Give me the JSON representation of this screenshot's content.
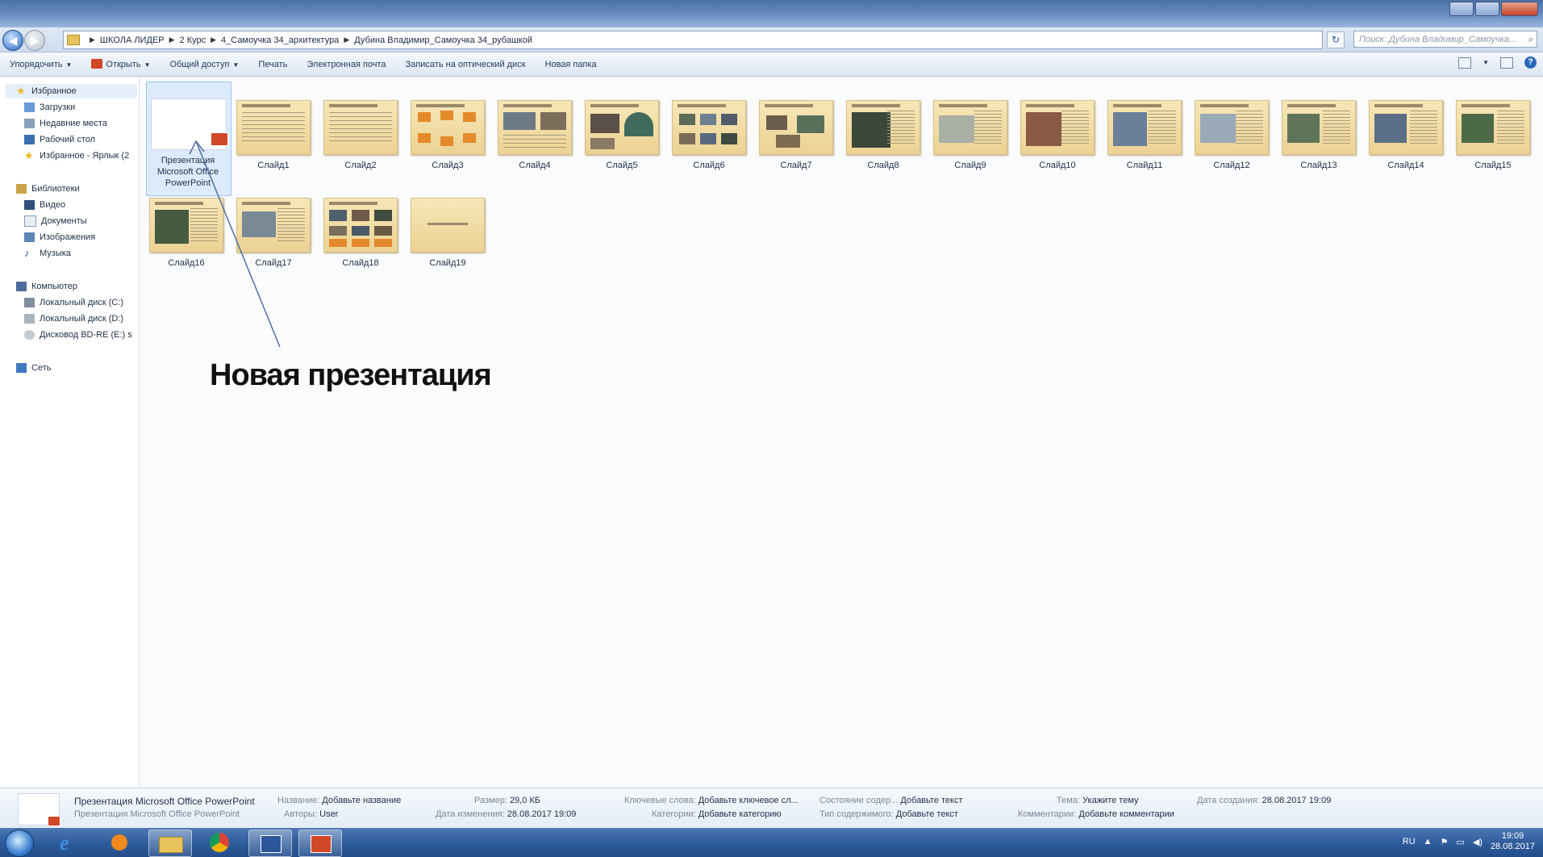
{
  "window": {
    "minimize_label": "–",
    "maximize_label": "□",
    "close_label": "x"
  },
  "address": {
    "back_glyph": "◀",
    "forward_glyph": "▶",
    "crumbs": [
      "ШКОЛА ЛИДЕР",
      "2 Курс",
      "4_Самоучка 34_архитектура",
      "Дубина Владимир_Самоучка 34_рубашкой"
    ],
    "refresh_glyph": "↻",
    "search_placeholder": "Поиск: Дубина Владимир_Самоучка..."
  },
  "toolbar": {
    "organize": "Упорядочить",
    "open": "Открыть",
    "share": "Общий доступ",
    "print": "Печать",
    "email": "Электронная почта",
    "burn": "Записать на оптический диск",
    "new_folder": "Новая папка",
    "help": "?"
  },
  "nav": {
    "favorites": "Избранное",
    "downloads": "Загрузки",
    "recent": "Недавние места",
    "desktop": "Рабочий стол",
    "fav_shortcut": "Избранное - Ярлык (2",
    "libraries": "Библиотеки",
    "video": "Видео",
    "documents": "Документы",
    "images": "Изображения",
    "music": "Музыка",
    "computer": "Компьютер",
    "disk_c": "Локальный диск (C:)",
    "disk_d": "Локальный диск (D:)",
    "disk_e": "Дисковод BD-RE (E:) s",
    "network": "Сеть"
  },
  "files": {
    "selected_label": "Презентация Microsoft Office PowerPoint",
    "slides": [
      "Слайд1",
      "Слайд2",
      "Слайд3",
      "Слайд4",
      "Слайд5",
      "Слайд6",
      "Слайд7",
      "Слайд8",
      "Слайд9",
      "Слайд10",
      "Слайд11",
      "Слайд12",
      "Слайд13",
      "Слайд14",
      "Слайд15",
      "Слайд16",
      "Слайд17",
      "Слайд18",
      "Слайд19"
    ]
  },
  "annotation": "Новая презентация",
  "details": {
    "name": "Презентация Microsoft Office PowerPoint",
    "type": "Презентация Microsoft Office PowerPoint",
    "title_k": "Название:",
    "title_v": "Добавьте название",
    "authors_k": "Авторы:",
    "authors_v": "User",
    "size_k": "Размер:",
    "size_v": "29,0 КБ",
    "modified_k": "Дата изменения:",
    "modified_v": "28.08.2017 19:09",
    "keywords_k": "Ключевые слова:",
    "keywords_v": "Добавьте ключевое сл...",
    "category_k": "Категории:",
    "category_v": "Добавьте категорию",
    "status_k": "Состояние содер...",
    "status_v": "Добавьте текст",
    "content_type_k": "Тип содержимого:",
    "content_type_v": "Добавьте текст",
    "subject_k": "Тема:",
    "subject_v": "Укажите тему",
    "comments_k": "Комментарии:",
    "comments_v": "Добавьте комментарии",
    "created_k": "Дата создания:",
    "created_v": "28.08.2017 19:09"
  },
  "taskbar": {
    "lang": "RU",
    "time": "19:09",
    "date": "28.08.2017"
  },
  "colors": {
    "ppt_accent": "#d24726",
    "selection": "#dcebfc",
    "taskbar": "#2f5c9c"
  }
}
